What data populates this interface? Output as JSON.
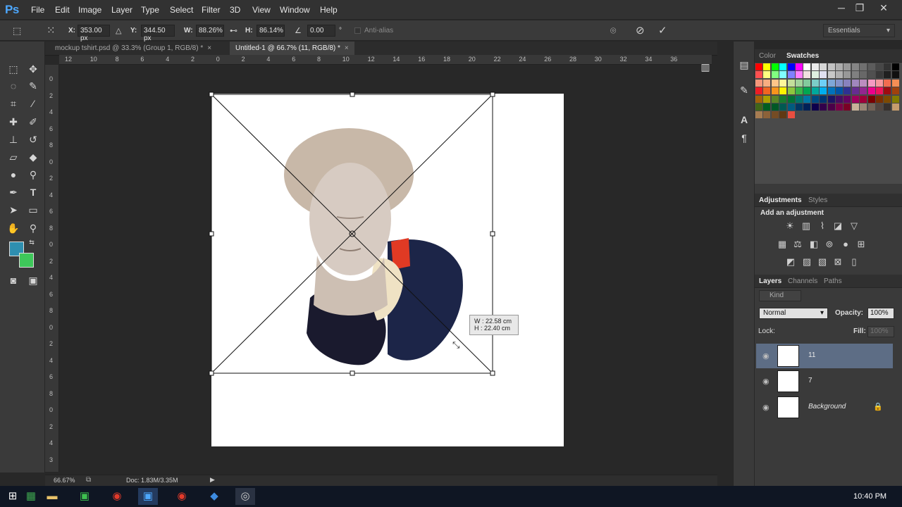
{
  "app": {
    "logo": "Ps"
  },
  "menu": [
    "File",
    "Edit",
    "Image",
    "Layer",
    "Type",
    "Select",
    "Filter",
    "3D",
    "View",
    "Window",
    "Help"
  ],
  "window_controls": [
    "─",
    "❐",
    "✕"
  ],
  "options": {
    "x_label": "X:",
    "x_value": "353.00 px",
    "y_label": "Y:",
    "y_value": "344.50 px",
    "w_label": "W:",
    "w_value": "88.26%",
    "h_label": "H:",
    "h_value": "86.14%",
    "angle_value": "0.00",
    "angle_unit": "°",
    "antialias": "Anti-alias",
    "workspace": "Essentials"
  },
  "tabs": [
    {
      "label": "mockup tshirt.psd @ 33.3% (Group 1, RGB/8) *",
      "close": "×"
    },
    {
      "label": "Untitled-1 @ 66.7% (11, RGB/8) *",
      "close": "×"
    }
  ],
  "ruler_top": [
    "12",
    "10",
    "8",
    "6",
    "4",
    "2",
    "0",
    "2",
    "4",
    "6",
    "8",
    "10",
    "12",
    "14",
    "16",
    "18",
    "20",
    "22",
    "24",
    "26",
    "28",
    "30",
    "32",
    "34",
    "36"
  ],
  "ruler_left": [
    "0",
    "2",
    "4",
    "6",
    "8",
    "0",
    "2",
    "4",
    "6",
    "8",
    "0",
    "2",
    "4",
    "6",
    "8",
    "0",
    "2",
    "4",
    "6",
    "8",
    "0",
    "2",
    "4",
    "3"
  ],
  "transform_readout": {
    "w_label": "W :",
    "w_value": "22.58 cm",
    "h_label": "H :",
    "h_value": "22.40 cm"
  },
  "status": {
    "zoom": "66.67%",
    "doc": "Doc: 1.83M/3.35M"
  },
  "color_panel": {
    "tabs": [
      "Color",
      "Swatches"
    ]
  },
  "adjustments_panel": {
    "tabs": [
      "Adjustments",
      "Styles"
    ],
    "heading": "Add an adjustment"
  },
  "layers_panel": {
    "tabs": [
      "Layers",
      "Channels",
      "Paths"
    ],
    "filter": "Kind",
    "blend_mode": "Normal",
    "opacity_label": "Opacity:",
    "opacity_value": "100%",
    "lock_label": "Lock:",
    "fill_label": "Fill:",
    "fill_value": "100%",
    "layers": [
      {
        "name": "11",
        "selected": true
      },
      {
        "name": "7",
        "selected": false
      },
      {
        "name": "Background",
        "selected": false,
        "locked": true
      }
    ]
  },
  "taskbar": {
    "clock": "10:40 PM"
  },
  "colors": {
    "accent": "#4da8ff",
    "foreground": "#2e8fb0",
    "background": "#3ec85a",
    "selection": "#5d6d85"
  }
}
